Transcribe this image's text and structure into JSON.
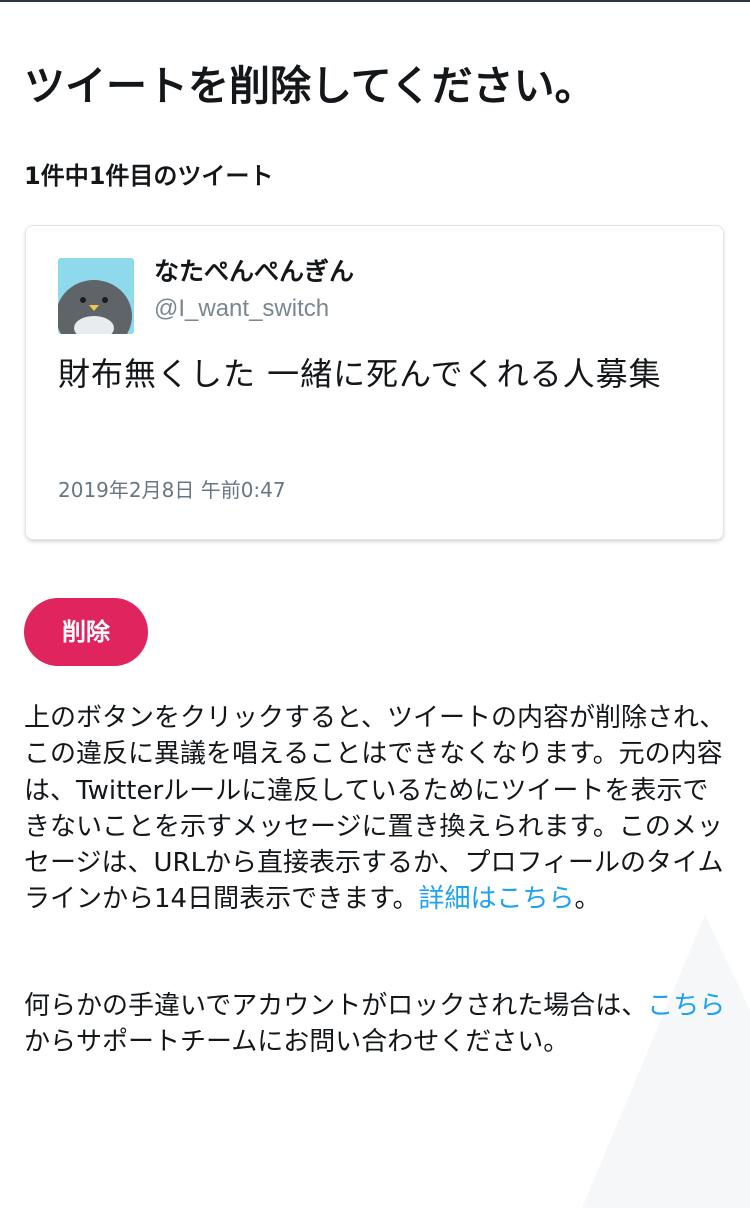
{
  "page": {
    "title": "ツイートを削除してください。",
    "tweet_count": "1件中1件目のツイート"
  },
  "tweet": {
    "display_name": "なたぺんぺんぎん",
    "handle": "@I_want_switch",
    "text": "財布無くした 一緒に死んでくれる人募集",
    "timestamp": "2019年2月8日 午前0:47",
    "avatar_icon": "penguin-avatar-icon"
  },
  "actions": {
    "delete_label": "削除"
  },
  "info": {
    "description": "上のボタンをクリックすると、ツイートの内容が削除され、この違反に異議を唱えることはできなくなります。元の内容は、Twitterルールに違反しているためにツイートを表示できないことを示すメッセージに置き換えられます。このメッセージは、URLから直接表示するか、プロフィールのタイムラインから14日間表示できます。",
    "details_link": "詳細はこちら",
    "description_end": "。",
    "support_prefix": "何らかの手違いでアカウントがロックされた場合は、",
    "support_link": "こちら",
    "support_suffix": "からサポートチームにお問い合わせください。"
  },
  "colors": {
    "accent_delete": "#e0245e",
    "link": "#1da1f2",
    "text_primary": "#14171a",
    "text_secondary": "#687682"
  }
}
